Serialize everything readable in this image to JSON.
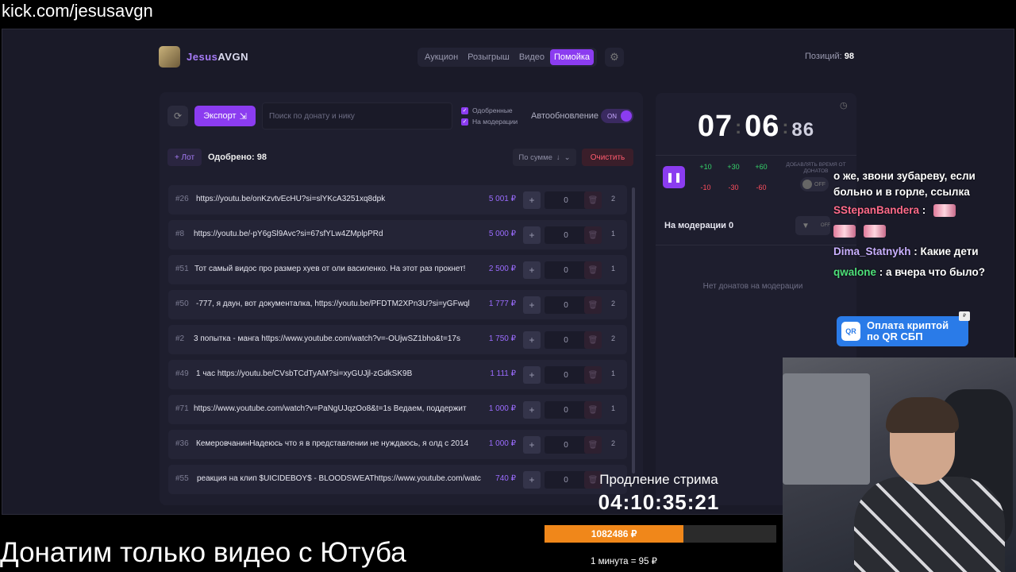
{
  "browser": {
    "url": "kick.com/jesusavgn"
  },
  "header": {
    "brand_a": "Jesus",
    "brand_b": "AVGN",
    "nav": [
      {
        "label": "Аукцион"
      },
      {
        "label": "Розыгрыш"
      },
      {
        "label": "Видео"
      },
      {
        "label": "Помойка",
        "active": true
      }
    ],
    "positions_label": "Позиций:",
    "positions_value": "98"
  },
  "toolbar": {
    "export_label": "Экспорт",
    "search_placeholder": "Поиск по донату и нику",
    "filter_approved": "Одобренные",
    "filter_moderation": "На модерации",
    "autoupdate_label": "Автообновление",
    "autoupdate_state": "ON"
  },
  "list_header": {
    "lot_button": "+ Лот",
    "approved_label": "Одобрено: 98",
    "sort_label": "По сумме",
    "clear_button": "Очистить"
  },
  "rows": [
    {
      "num": "#26",
      "text": "https://youtu.be/onKzvtvEcHU?si=slYKcA3251xq8dpk",
      "amount": "5 001 ₽",
      "qty": "0",
      "count": "2"
    },
    {
      "num": "#8",
      "text": "https://youtu.be/-pY6gSl9Avc?si=67sfYLw4ZMplpPRd",
      "amount": "5 000 ₽",
      "qty": "0",
      "count": "1"
    },
    {
      "num": "#51",
      "text": "Тот самый видос про размер хуев от оли василенко. На этот раз прокнет!",
      "amount": "2 500 ₽",
      "qty": "0",
      "count": "1"
    },
    {
      "num": "#50",
      "text": "-777, я даун, вот документалка, https://youtu.be/PFDTM2XPn3U?si=yGFwql",
      "amount": "1 777 ₽",
      "qty": "0",
      "count": "2"
    },
    {
      "num": "#2",
      "text": "3 попытка - манга https://www.youtube.com/watch?v=-OUjwSZ1bho&t=17s",
      "amount": "1 750 ₽",
      "qty": "0",
      "count": "2"
    },
    {
      "num": "#49",
      "text": "1 час https://youtu.be/CVsbTCdTyAM?si=xyGUJjl-zGdkSK9B",
      "amount": "1 111 ₽",
      "qty": "0",
      "count": "1"
    },
    {
      "num": "#71",
      "text": "https://www.youtube.com/watch?v=PaNgUJqzOo8&t=1s Ведаем, поддержит",
      "amount": "1 000 ₽",
      "qty": "0",
      "count": "1"
    },
    {
      "num": "#36",
      "text": "КемеровчанинНадеюсь что я в представлении не нуждаюсь, я олд с 2014",
      "amount": "1 000 ₽",
      "qty": "0",
      "count": "2"
    },
    {
      "num": "#55",
      "text": "реакция на клип $UICIDEBOY$ - BLOODSWEAThttps://www.youtube.com/watc",
      "amount": "740 ₽",
      "qty": "0",
      "count": ""
    }
  ],
  "timer": {
    "hours": "07",
    "minutes": "06",
    "ms": "86",
    "plus": [
      "+10",
      "+30",
      "+60"
    ],
    "minus": [
      "-10",
      "-30",
      "-60"
    ],
    "add_time_label": "ДОБАВЛЯТЬ ВРЕМЯ ОТ ДОНАТОВ",
    "toggle_state": "OFF"
  },
  "moderation": {
    "title": "На модерации",
    "count": "0",
    "filter_state": "OFF",
    "empty_text": "Нет донатов на модерации"
  },
  "chat": {
    "msg0": "о же, звони зубареву, если больно и в горле, ссылка",
    "msg1_user": "SStepanBandera",
    "msg2_user": "Dima_Statnykh",
    "msg2_text": "Какие дети",
    "msg3_user": "qwalone",
    "msg3_text": "а вчера что было?"
  },
  "qr_widget": {
    "line1": "Оплата криптой",
    "line2": "по QR СБП",
    "icon_text": "QR"
  },
  "stream_overlay": {
    "prolong_label": "Продление стрима",
    "prolong_timer": "04:10:35:21",
    "bar_value": "1082486 ₽",
    "bar_progress": 0.6,
    "rate": "1 минута = 95 ₽",
    "bottom_text": "Донатим только видео с Ютуба"
  },
  "colors": {
    "accent": "#8b3cf0",
    "amount": "#9b6cff",
    "bar": "#f0871a"
  }
}
